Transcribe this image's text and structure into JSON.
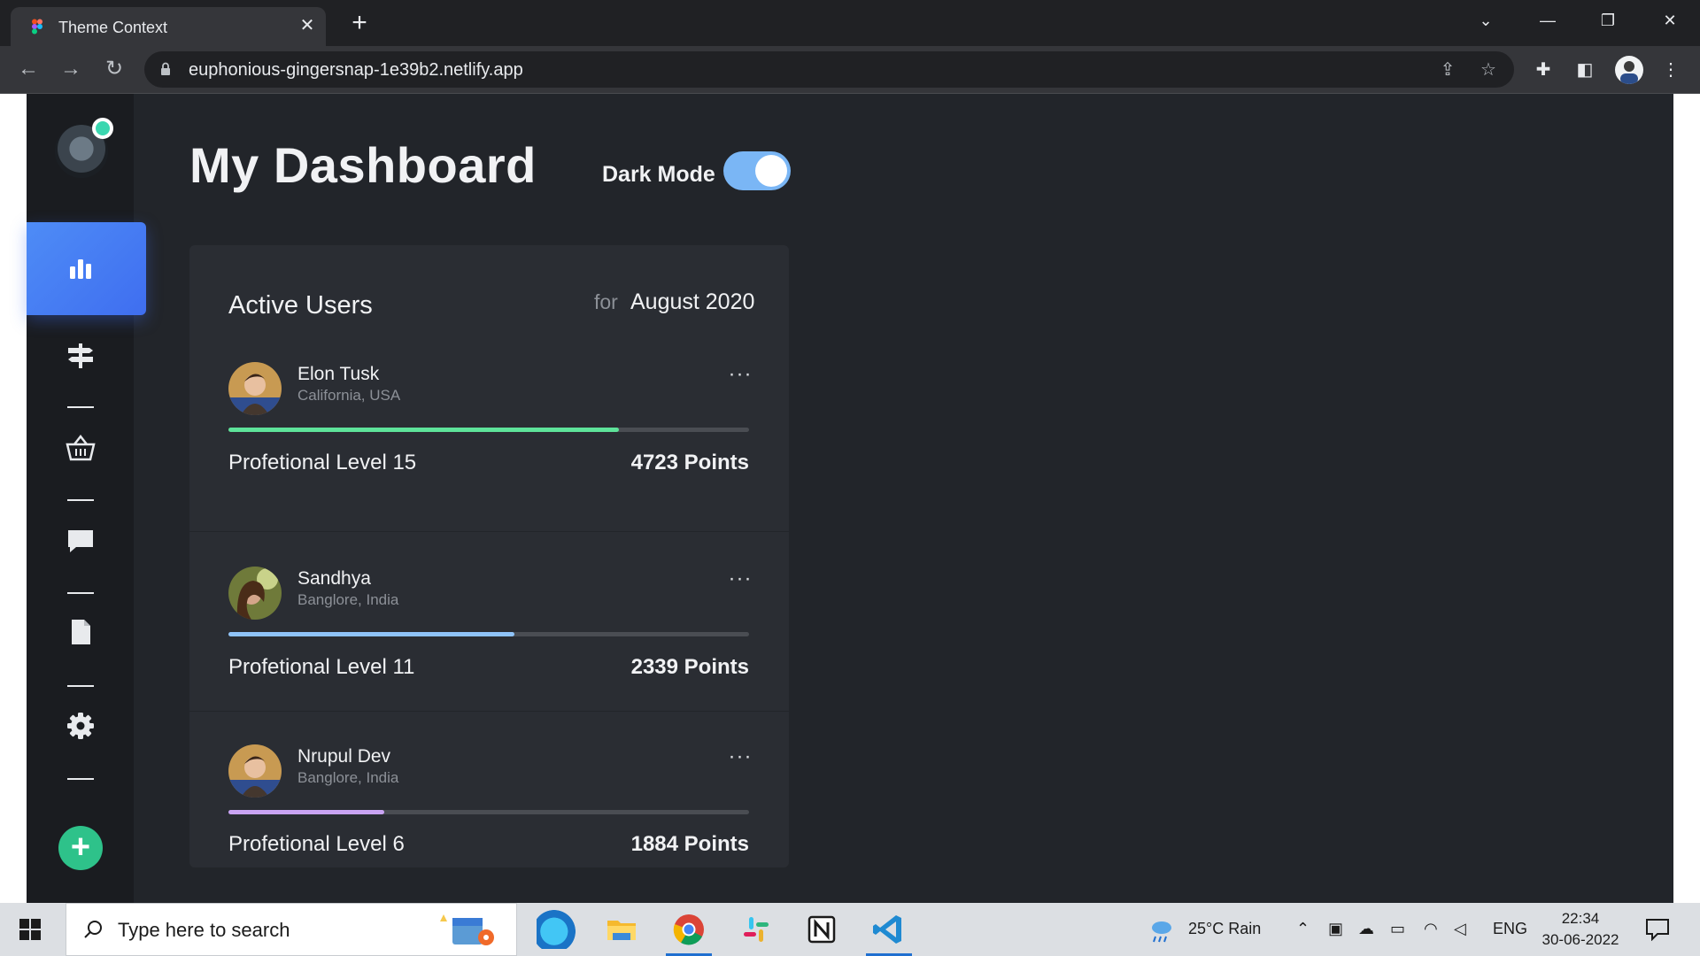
{
  "browser": {
    "tab_title": "Theme Context",
    "url": "euphonious-gingersnap-1e39b2.netlify.app"
  },
  "sidebar": {
    "items": [
      {
        "icon": "bar-chart-icon",
        "active": true
      },
      {
        "icon": "signpost-icon"
      },
      {
        "icon": "basket-icon"
      },
      {
        "icon": "chat-icon"
      },
      {
        "icon": "document-icon"
      },
      {
        "icon": "gear-icon"
      }
    ],
    "add_icon": "plus-icon"
  },
  "header": {
    "title": "My Dashboard",
    "dark_mode_label": "Dark Mode",
    "dark_mode_on": true
  },
  "card": {
    "title": "Active Users",
    "for_label": "for",
    "period": "August 2020",
    "users": [
      {
        "name": "Elon Tusk",
        "location": "California, USA",
        "level": "Profetional Level 15",
        "points": "4723 Points",
        "more": "···",
        "progress": 0.75,
        "color": "#5ee39a"
      },
      {
        "name": "Sandhya",
        "location": "Banglore, India",
        "level": "Profetional Level 11",
        "points": "2339 Points",
        "more": "···",
        "progress": 0.55,
        "color": "#8fc3f8"
      },
      {
        "name": "Nrupul Dev",
        "location": "Banglore, India",
        "level": "Profetional Level 6",
        "points": "1884 Points",
        "more": "···",
        "progress": 0.3,
        "color": "#c9a3f3"
      }
    ]
  },
  "taskbar": {
    "search_placeholder": "Type here to search",
    "weather": "25°C  Rain",
    "language": "ENG",
    "time": "22:34",
    "date": "30-06-2022"
  },
  "colors": {
    "page_bg": "#22252a",
    "sidebar_bg": "#1a1c20",
    "card_bg": "#2a2d33",
    "accent_blue": "#4e8cf6",
    "add_green": "#2ec28a",
    "toggle": "#7ab6f5"
  }
}
